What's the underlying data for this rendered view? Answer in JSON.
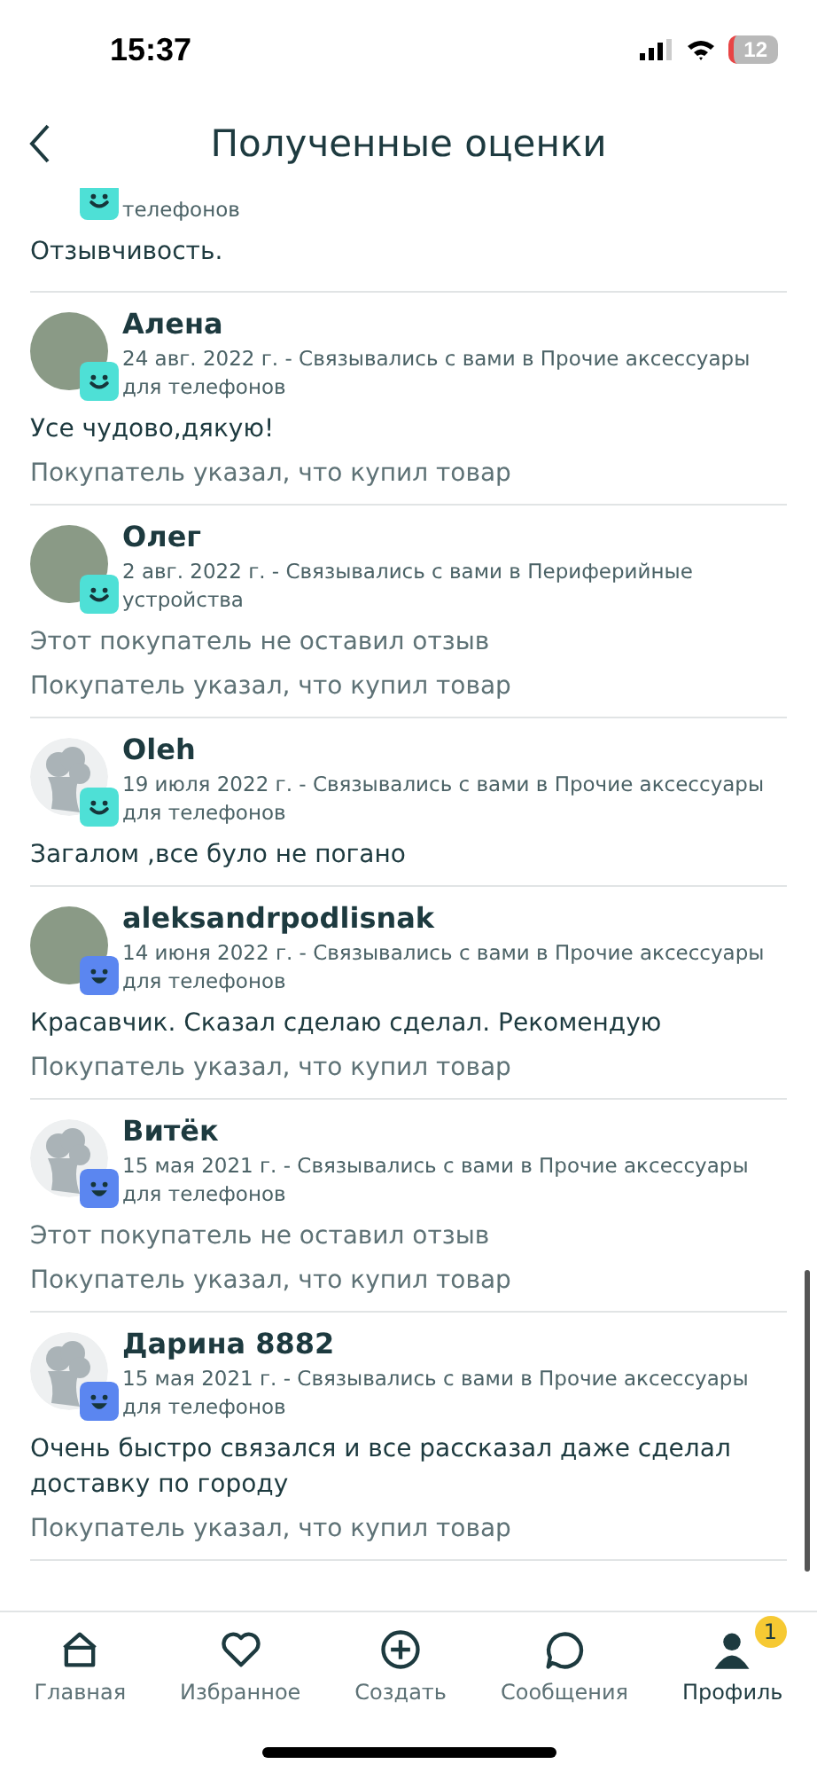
{
  "status_bar": {
    "time": "15:37",
    "battery": "12"
  },
  "header": {
    "title": "Полученные оценки"
  },
  "top_fragment": {
    "badge": {
      "kind": "smile"
    },
    "meta": "телефонов",
    "comment": "Отзывчивость."
  },
  "reviews": [
    {
      "name": "Алена",
      "avatar": {
        "kind": "photo"
      },
      "badge": {
        "kind": "smile"
      },
      "meta": "24 авг. 2022 г. - Связывались с вами в Прочие аксессуары для телефонов",
      "comment": "Усе чудово,дякую!",
      "bought": "Покупатель указал, что купил товар"
    },
    {
      "name": "Олег",
      "avatar": {
        "kind": "photo"
      },
      "badge": {
        "kind": "smile"
      },
      "meta": "2 авг. 2022 г. - Связывались с вами в Периферийные устройства",
      "note": "Этот покупатель не оставил отзыв",
      "bought": "Покупатель указал, что купил товар"
    },
    {
      "name": "Oleh",
      "avatar": {
        "kind": "default"
      },
      "badge": {
        "kind": "smile"
      },
      "meta": "19 июля 2022 г. - Связывались с вами в Прочие аксессуары для телефонов",
      "comment": "Загалом ,все було не погано"
    },
    {
      "name": "aleksandrpodlisnak",
      "avatar": {
        "kind": "photo"
      },
      "badge": {
        "kind": "grin"
      },
      "meta": "14 июня 2022 г. - Связывались с вами в Прочие аксессуары для телефонов",
      "comment": "Красавчик. Сказал сделаю сделал. Рекомендую",
      "bought": "Покупатель указал, что купил товар"
    },
    {
      "name": "Витёк",
      "avatar": {
        "kind": "default"
      },
      "badge": {
        "kind": "grin"
      },
      "meta": "15 мая 2021 г. - Связывались с вами в Прочие аксессуары для телефонов",
      "note": "Этот покупатель не оставил отзыв",
      "bought": "Покупатель указал, что купил товар"
    },
    {
      "name": "Дарина 8882",
      "avatar": {
        "kind": "default"
      },
      "badge": {
        "kind": "grin"
      },
      "meta": "15 мая 2021 г. - Связывались с вами в Прочие аксессуары для телефонов",
      "comment": "Очень быстро связался и все рассказал даже сделал доставку по городу",
      "bought": "Покупатель указал, что купил товар"
    }
  ],
  "nav": [
    {
      "kind": "home",
      "label": "Главная",
      "selected": false
    },
    {
      "kind": "heart",
      "label": "Избранное",
      "selected": false
    },
    {
      "kind": "plus",
      "label": "Создать",
      "selected": false
    },
    {
      "kind": "chat",
      "label": "Сообщения",
      "selected": false
    },
    {
      "kind": "person",
      "label": "Профиль",
      "selected": true,
      "badge": "1"
    }
  ]
}
